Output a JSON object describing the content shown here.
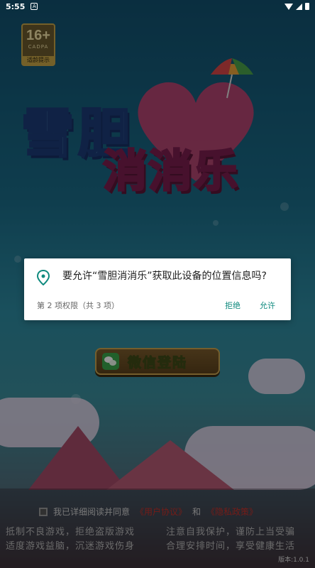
{
  "status_bar": {
    "time": "5:55",
    "notification_icon": "A",
    "icons": [
      "wifi-icon",
      "signal-icon",
      "battery-icon"
    ]
  },
  "age_rating": {
    "number": "16+",
    "org": "CADPA",
    "hint": "适龄提示"
  },
  "logo": {
    "line1": "雪胆",
    "line2": "消消乐"
  },
  "login": {
    "wechat_label": "微信登陆"
  },
  "agreement": {
    "prefix": "我已详细阅读并同意",
    "user_agreement": "《用户协议》",
    "and": "和",
    "privacy_policy": "《隐私政策》"
  },
  "health_notice": {
    "line1_left": "抵制不良游戏，拒绝盗版游戏",
    "line1_right": "注意自我保护，谨防上当受骗",
    "line2_left": "适度游戏益脑，沉迷游戏伤身",
    "line2_right": "合理安排时间，享受健康生活"
  },
  "version": "版本:1.0.1",
  "permission_dialog": {
    "message": "要允许“雪胆消消乐”获取此设备的位置信息吗?",
    "counter": "第 2 项权限（共 3 项）",
    "deny_label": "拒绝",
    "allow_label": "允许"
  },
  "colors": {
    "dialog_button": "#0f8a7e",
    "link_red": "#c8312a",
    "wechat_green": "#3aa64a"
  }
}
